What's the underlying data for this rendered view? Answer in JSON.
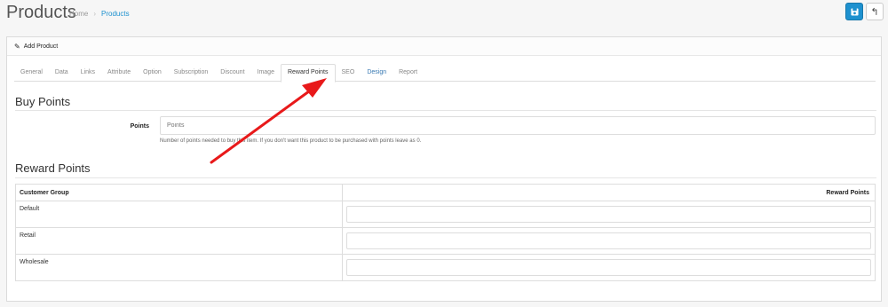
{
  "header": {
    "title": "Products",
    "breadcrumb": [
      "Home",
      "Products"
    ],
    "save_icon": "save-icon",
    "back_icon": "reply-icon"
  },
  "panel": {
    "heading": "Add Product",
    "heading_icon": "pencil-icon"
  },
  "tabs": [
    {
      "label": "General"
    },
    {
      "label": "Data"
    },
    {
      "label": "Links"
    },
    {
      "label": "Attribute"
    },
    {
      "label": "Option"
    },
    {
      "label": "Subscription"
    },
    {
      "label": "Discount"
    },
    {
      "label": "Image"
    },
    {
      "label": "Reward Points"
    },
    {
      "label": "SEO"
    },
    {
      "label": "Design"
    },
    {
      "label": "Report"
    }
  ],
  "buy_points": {
    "title": "Buy Points",
    "label": "Points",
    "placeholder": "Points",
    "help": "Number of points needed to buy this item. If you don't want this product to be purchased with points leave as 0."
  },
  "reward_points": {
    "title": "Reward Points",
    "col_group": "Customer Group",
    "col_points": "Reward Points",
    "rows": [
      {
        "group": "Default"
      },
      {
        "group": "Retail"
      },
      {
        "group": "Wholesale"
      }
    ]
  },
  "colors": {
    "accent": "#1e91cf",
    "annotation_arrow": "#e8191a"
  }
}
